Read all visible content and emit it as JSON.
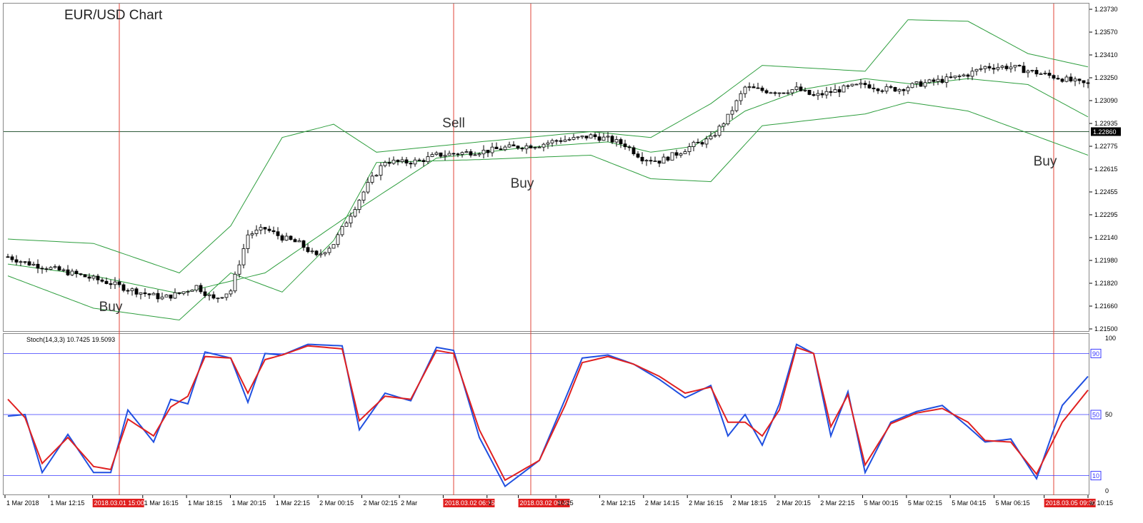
{
  "chart_data": [
    {
      "type": "candlestick",
      "title": "EUR/USD Chart",
      "ylim": [
        1.215,
        1.2373
      ],
      "y_ticks": [
        "1.23730",
        "1.23570",
        "1.23410",
        "1.23250",
        "1.23090",
        "1.22935",
        "1.22775",
        "1.22615",
        "1.22455",
        "1.22295",
        "1.22140",
        "1.21980",
        "1.21820",
        "1.21660",
        "1.21500"
      ],
      "current_price": "1.22860",
      "candles_count": 253,
      "close_waypoints": [
        [
          0,
          1.2201
        ],
        [
          4,
          1.2197
        ],
        [
          10,
          1.2193
        ],
        [
          16,
          1.2189
        ],
        [
          20,
          1.2186
        ],
        [
          24,
          1.2183
        ],
        [
          28,
          1.2179
        ],
        [
          32,
          1.2176
        ],
        [
          36,
          1.2173
        ],
        [
          40,
          1.2176
        ],
        [
          44,
          1.2181
        ],
        [
          48,
          1.2172
        ],
        [
          52,
          1.2178
        ],
        [
          56,
          1.2216
        ],
        [
          60,
          1.222
        ],
        [
          64,
          1.2214
        ],
        [
          68,
          1.221
        ],
        [
          72,
          1.2201
        ],
        [
          76,
          1.221
        ],
        [
          80,
          1.223
        ],
        [
          84,
          1.225
        ],
        [
          88,
          1.2266
        ],
        [
          92,
          1.2265
        ],
        [
          96,
          1.2266
        ],
        [
          100,
          1.227
        ],
        [
          104,
          1.2271
        ],
        [
          108,
          1.2272
        ],
        [
          112,
          1.2273
        ],
        [
          116,
          1.2275
        ],
        [
          120,
          1.2276
        ],
        [
          124,
          1.2277
        ],
        [
          128,
          1.228
        ],
        [
          132,
          1.2281
        ],
        [
          136,
          1.2283
        ],
        [
          140,
          1.2281
        ],
        [
          144,
          1.2277
        ],
        [
          148,
          1.2268
        ],
        [
          152,
          1.2266
        ],
        [
          156,
          1.2271
        ],
        [
          160,
          1.2277
        ],
        [
          164,
          1.2281
        ],
        [
          168,
          1.2296
        ],
        [
          172,
          1.2316
        ],
        [
          176,
          1.2314
        ],
        [
          180,
          1.2313
        ],
        [
          184,
          1.2315
        ],
        [
          188,
          1.231
        ],
        [
          192,
          1.2313
        ],
        [
          196,
          1.2316
        ],
        [
          200,
          1.2318
        ],
        [
          204,
          1.2315
        ],
        [
          208,
          1.2315
        ],
        [
          212,
          1.2318
        ],
        [
          216,
          1.232
        ],
        [
          220,
          1.2322
        ],
        [
          224,
          1.2325
        ],
        [
          228,
          1.233
        ],
        [
          232,
          1.233
        ],
        [
          234,
          1.233
        ],
        [
          240,
          1.2326
        ],
        [
          246,
          1.2322
        ],
        [
          250,
          1.2319
        ],
        [
          252,
          1.2318
        ]
      ],
      "bollinger": {
        "middle_waypoints": [
          [
            0,
            1.2196
          ],
          [
            20,
            1.2188
          ],
          [
            40,
            1.2176
          ],
          [
            60,
            1.219
          ],
          [
            80,
            1.223
          ],
          [
            100,
            1.2268
          ],
          [
            120,
            1.2275
          ],
          [
            140,
            1.2279
          ],
          [
            150,
            1.2272
          ],
          [
            160,
            1.2276
          ],
          [
            172,
            1.23
          ],
          [
            186,
            1.2315
          ],
          [
            200,
            1.2322
          ],
          [
            212,
            1.2318
          ],
          [
            224,
            1.2322
          ],
          [
            238,
            1.2318
          ],
          [
            252,
            1.2296
          ]
        ],
        "upper_waypoints": [
          [
            0,
            1.2213
          ],
          [
            20,
            1.221
          ],
          [
            40,
            1.219
          ],
          [
            52,
            1.2222
          ],
          [
            64,
            1.2282
          ],
          [
            76,
            1.2291
          ],
          [
            86,
            1.2272
          ],
          [
            110,
            1.2279
          ],
          [
            136,
            1.2286
          ],
          [
            150,
            1.2282
          ],
          [
            164,
            1.2305
          ],
          [
            176,
            1.2331
          ],
          [
            200,
            1.2327
          ],
          [
            210,
            1.2362
          ],
          [
            224,
            1.2361
          ],
          [
            238,
            1.2339
          ],
          [
            252,
            1.233
          ]
        ],
        "lower_waypoints": [
          [
            0,
            1.2188
          ],
          [
            20,
            1.2166
          ],
          [
            40,
            1.2158
          ],
          [
            52,
            1.219
          ],
          [
            64,
            1.2177
          ],
          [
            76,
            1.2212
          ],
          [
            86,
            1.2265
          ],
          [
            110,
            1.2267
          ],
          [
            136,
            1.227
          ],
          [
            150,
            1.2254
          ],
          [
            164,
            1.2252
          ],
          [
            176,
            1.229
          ],
          [
            200,
            1.2298
          ],
          [
            210,
            1.2306
          ],
          [
            224,
            1.23
          ],
          [
            238,
            1.2285
          ],
          [
            252,
            1.227
          ]
        ]
      },
      "annotations": [
        {
          "label": "Buy",
          "candle": 24,
          "price": 1.2164
        },
        {
          "label": "Sell",
          "candle": 104,
          "price": 1.2289
        },
        {
          "label": "Buy",
          "candle": 120,
          "price": 1.2248
        },
        {
          "label": "Buy",
          "candle": 242,
          "price": 1.2263
        }
      ],
      "vertical_markers": [
        26,
        104,
        122,
        244
      ],
      "colors": {
        "bull_fill": "#ffffff",
        "bear_fill": "#000000",
        "bands": "#2e9e3e",
        "marker": "#e0443a",
        "price_line": "#2e5a3a"
      }
    },
    {
      "type": "line",
      "title": "Stoch(14,3,3) 10.7425 19.5093",
      "ylim": [
        0,
        100
      ],
      "y_ticks": [
        "100",
        "50",
        "0"
      ],
      "levels": [
        {
          "value": 90,
          "label": "90"
        },
        {
          "value": 50,
          "label": "50"
        },
        {
          "value": 10,
          "label": "10"
        }
      ],
      "series": [
        {
          "name": "",
          "color": "#2050e0",
          "waypoints": [
            [
              0,
              49
            ],
            [
              4,
              50
            ],
            [
              8,
              12
            ],
            [
              14,
              37
            ],
            [
              20,
              12
            ],
            [
              24,
              12
            ],
            [
              28,
              53
            ],
            [
              34,
              32
            ],
            [
              38,
              60
            ],
            [
              42,
              57
            ],
            [
              46,
              91
            ],
            [
              52,
              87
            ],
            [
              56,
              58
            ],
            [
              60,
              90
            ],
            [
              64,
              89
            ],
            [
              70,
              96
            ],
            [
              78,
              95
            ],
            [
              82,
              40
            ],
            [
              88,
              64
            ],
            [
              94,
              59
            ],
            [
              100,
              94
            ],
            [
              104,
              92
            ],
            [
              110,
              35
            ],
            [
              116,
              3
            ],
            [
              124,
              20
            ],
            [
              130,
              60
            ],
            [
              134,
              87
            ],
            [
              140,
              89
            ],
            [
              146,
              83
            ],
            [
              152,
              73
            ],
            [
              158,
              61
            ],
            [
              164,
              69
            ],
            [
              168,
              36
            ],
            [
              172,
              50
            ],
            [
              176,
              30
            ],
            [
              180,
              57
            ],
            [
              184,
              96
            ],
            [
              188,
              90
            ],
            [
              192,
              36
            ],
            [
              196,
              65
            ],
            [
              200,
              12
            ],
            [
              206,
              45
            ],
            [
              212,
              52
            ],
            [
              218,
              56
            ],
            [
              224,
              42
            ],
            [
              228,
              32
            ],
            [
              234,
              34
            ],
            [
              240,
              8
            ],
            [
              246,
              56
            ],
            [
              252,
              75
            ]
          ]
        },
        {
          "name": "",
          "color": "#e02020",
          "waypoints": [
            [
              0,
              60
            ],
            [
              4,
              48
            ],
            [
              8,
              18
            ],
            [
              14,
              35
            ],
            [
              20,
              16
            ],
            [
              24,
              14
            ],
            [
              28,
              47
            ],
            [
              34,
              36
            ],
            [
              38,
              55
            ],
            [
              42,
              62
            ],
            [
              46,
              88
            ],
            [
              52,
              87
            ],
            [
              56,
              64
            ],
            [
              60,
              86
            ],
            [
              64,
              89
            ],
            [
              70,
              95
            ],
            [
              78,
              93
            ],
            [
              82,
              46
            ],
            [
              88,
              62
            ],
            [
              94,
              60
            ],
            [
              100,
              92
            ],
            [
              104,
              90
            ],
            [
              110,
              40
            ],
            [
              116,
              7
            ],
            [
              124,
              20
            ],
            [
              130,
              56
            ],
            [
              134,
              84
            ],
            [
              140,
              88
            ],
            [
              146,
              83
            ],
            [
              152,
              75
            ],
            [
              158,
              64
            ],
            [
              164,
              68
            ],
            [
              168,
              45
            ],
            [
              172,
              45
            ],
            [
              176,
              36
            ],
            [
              180,
              53
            ],
            [
              184,
              94
            ],
            [
              188,
              90
            ],
            [
              192,
              42
            ],
            [
              196,
              63
            ],
            [
              200,
              17
            ],
            [
              206,
              44
            ],
            [
              212,
              51
            ],
            [
              218,
              54
            ],
            [
              224,
              45
            ],
            [
              228,
              33
            ],
            [
              234,
              32
            ],
            [
              240,
              11
            ],
            [
              246,
              45
            ],
            [
              252,
              66
            ]
          ]
        }
      ]
    }
  ],
  "x_labels": [
    "1 Mar 2018",
    "1 Mar 12:15",
    "2018.03.01 15:00",
    "1 Mar 16:15",
    "1 Mar 18:15",
    "1 Mar 20:15",
    "1 Mar 22:15",
    "2 Mar 00:15",
    "2 Mar 02:15",
    "2 Mar",
    "2018.03.02 06:15",
    "2",
    "2018.03.02 09:45",
    "10:15",
    "2 Mar 12:15",
    "2 Mar 14:15",
    "2 Mar 16:15",
    "2 Mar 18:15",
    "2 Mar 20:15",
    "2 Mar 22:15",
    "5 Mar 00:15",
    "5 Mar 02:15",
    "5 Mar 04:15",
    "5 Mar 06:15",
    "2018.03.05 09:30",
    "ar 10:15"
  ],
  "x_label_positions": [
    0,
    7,
    14,
    22,
    29,
    36,
    43,
    50,
    57,
    63,
    70,
    77,
    82,
    88,
    95,
    102,
    109,
    116,
    123,
    130,
    137,
    144,
    151,
    158,
    166,
    173
  ],
  "highlight_labels": [
    2,
    10,
    12,
    24
  ]
}
